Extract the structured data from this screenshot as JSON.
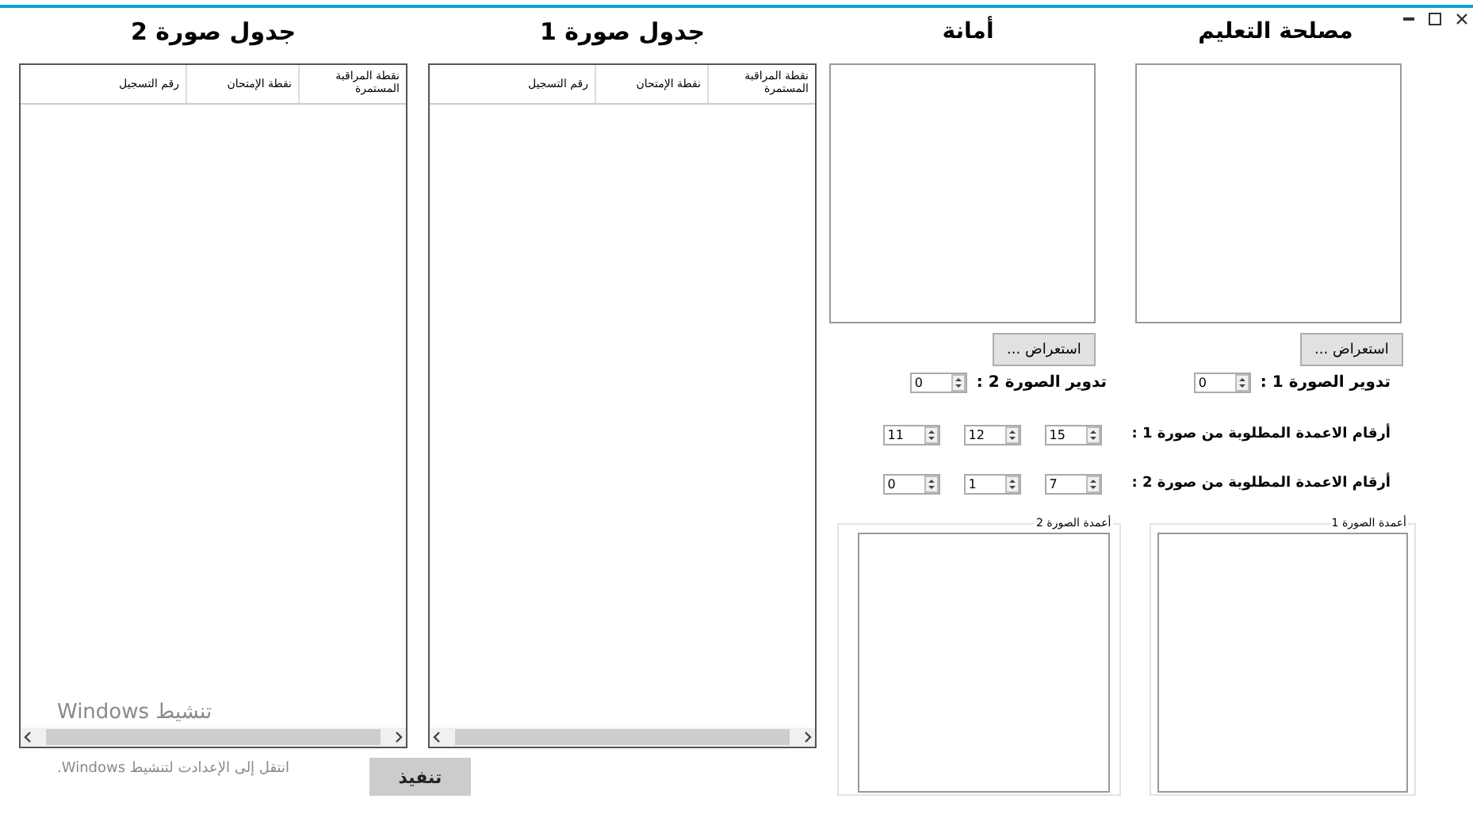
{
  "image_panels": [
    {
      "title": "مصلحة التعليم",
      "browse_button": "استعراض ...",
      "rotation_label": "تدوير الصورة 1 :",
      "rotation_value": "0",
      "group_title": "أعمدة الصورة 1"
    },
    {
      "title": "أمانة",
      "browse_button": "استعراض ...",
      "rotation_label": "تدوير الصورة 2 :",
      "rotation_value": "0",
      "group_title": "أعمدة الصورة 2"
    }
  ],
  "column_rows": [
    {
      "label": "أرقام الاعمدة المطلوبة من صورة 1 :",
      "values": [
        "15",
        "12",
        "11"
      ]
    },
    {
      "label": "أرقام الاعمدة المطلوبة من صورة 2 :",
      "values": [
        "7",
        "1",
        "0"
      ]
    }
  ],
  "tables": [
    {
      "title": "جدول صورة 1",
      "columns": [
        "نقطة المراقبة المستمرة",
        "نقطة الإمتحان",
        "رقم التسجيل"
      ]
    },
    {
      "title": "جدول صورة 2",
      "columns": [
        "نقطة المراقبة المستمرة",
        "نقطة الإمتحان",
        "رقم التسجيل"
      ]
    }
  ],
  "execute_button": "تنفيذ",
  "activation_notice": {
    "title": "تنشيط Windows",
    "text": "انتقل إلى الإعدادت لتنشيط Windows."
  }
}
